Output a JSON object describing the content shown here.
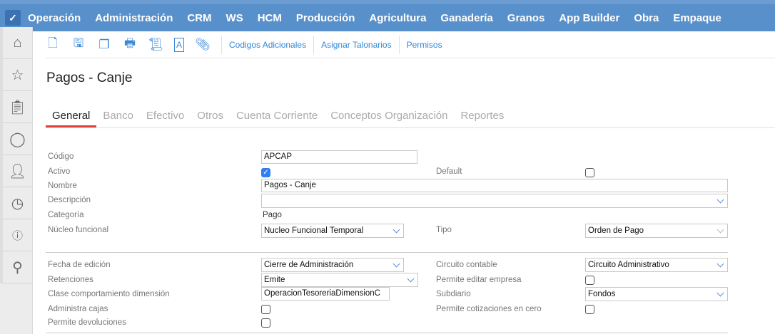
{
  "topbar": {
    "menus": [
      "Operación",
      "Administración",
      "CRM",
      "WS",
      "HCM",
      "Producción",
      "Agricultura",
      "Ganadería",
      "Granos",
      "App Builder",
      "Obra",
      "Empaque"
    ]
  },
  "toolbar": {
    "links": [
      "Codigos Adicionales",
      "Asignar Talonarios",
      "Permisos"
    ]
  },
  "page": {
    "title": "Pagos - Canje"
  },
  "tabs": [
    "General",
    "Banco",
    "Efectivo",
    "Otros",
    "Cuenta Corriente",
    "Conceptos Organización",
    "Reportes"
  ],
  "form": {
    "codigo_label": "Código",
    "codigo": "APCAP",
    "activo_label": "Activo",
    "activo": true,
    "default_label": "Default",
    "default": false,
    "nombre_label": "Nombre",
    "nombre": "Pagos - Canje",
    "descripcion_label": "Descripción",
    "descripcion": "",
    "categoria_label": "Categoría",
    "categoria": "Pago",
    "nucleo_label": "Núcleo funcional",
    "nucleo": "Nucleo Funcional Temporal",
    "tipo_label": "Tipo",
    "tipo": "Orden de Pago",
    "fecha_label": "Fecha de edición",
    "fecha": "Cierre de Administración",
    "circuito_label": "Circuito contable",
    "circuito": "Circuito Administrativo",
    "retenciones_label": "Retenciones",
    "retenciones": "Emite",
    "editar_empresa_label": "Permite editar empresa",
    "editar_empresa": false,
    "clase_label": "Clase comportamiento dimensión",
    "clase": "OperacionTesoreriaDimensionC",
    "subdiario_label": "Subdiario",
    "subdiario": "Fondos",
    "cajas_label": "Administra cajas",
    "cajas": false,
    "cotizaciones_label": "Permite cotizaciones en cero",
    "cotizaciones": false,
    "devoluciones_label": "Permite devoluciones",
    "devoluciones": false
  }
}
